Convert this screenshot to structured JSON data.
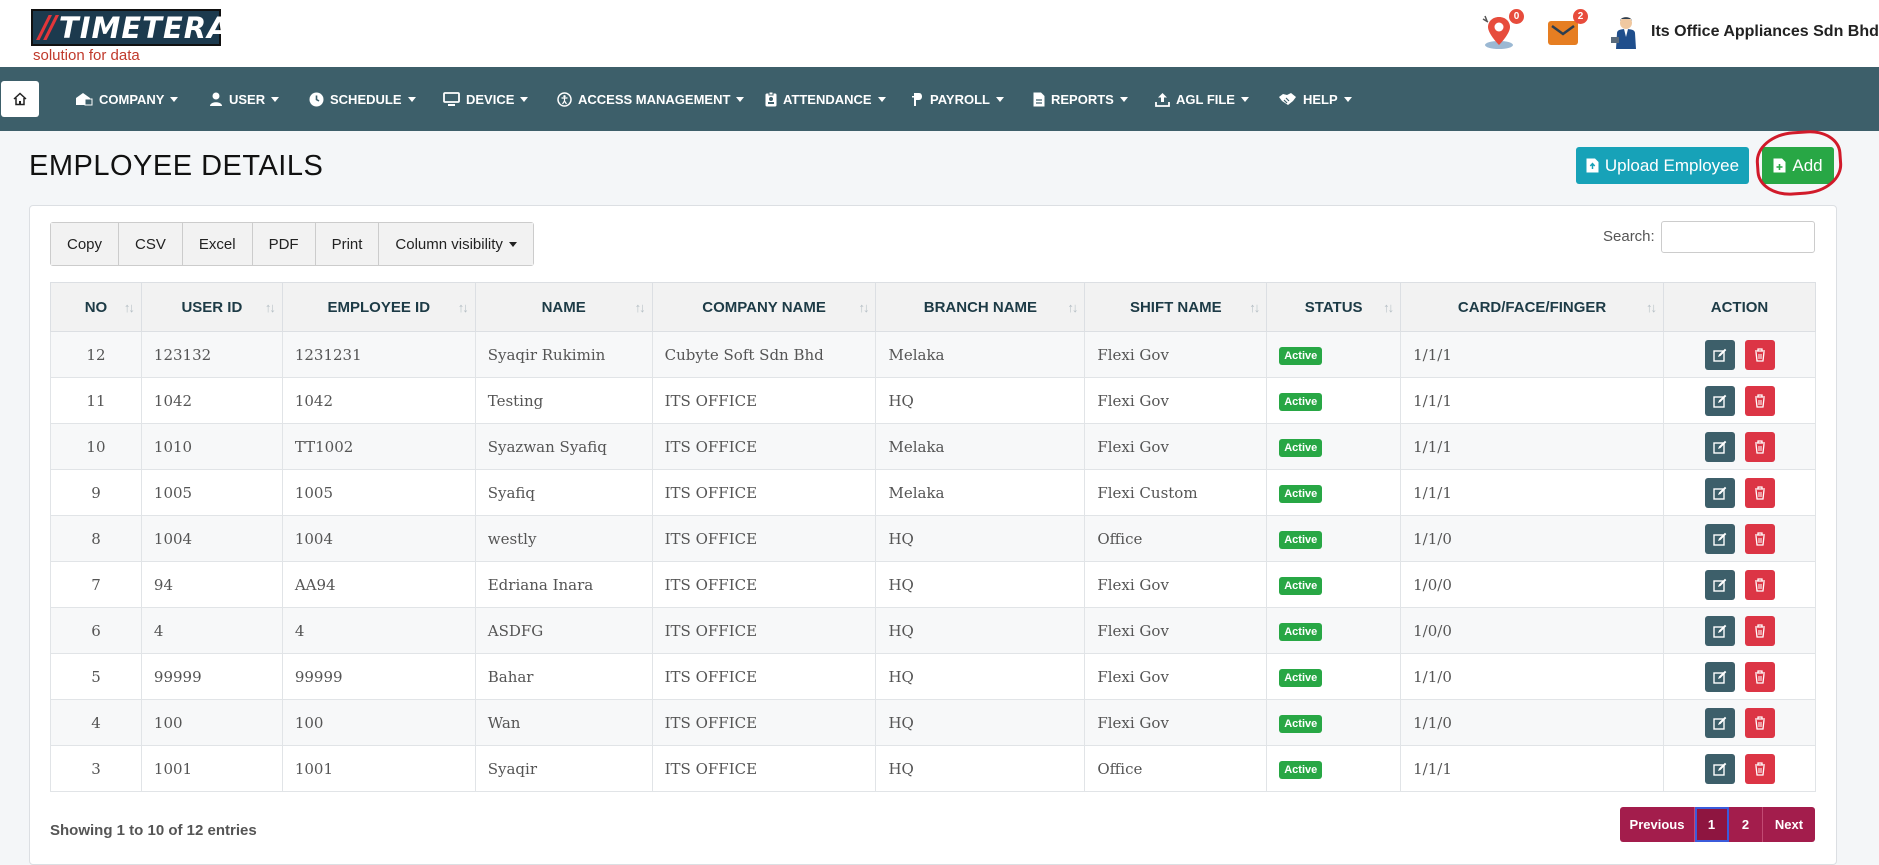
{
  "header": {
    "logo_text": "TIMETERA",
    "logo_slashes": "//",
    "logo_tagline": "solution for data",
    "location_badge": "0",
    "mail_badge": "2",
    "company": "Its Office Appliances Sdn Bhd"
  },
  "nav": {
    "items": [
      {
        "label": "COMPANY",
        "icon": "company-icon"
      },
      {
        "label": "USER",
        "icon": "user-icon"
      },
      {
        "label": "SCHEDULE",
        "icon": "clock-icon"
      },
      {
        "label": "DEVICE",
        "icon": "monitor-icon"
      },
      {
        "label": "ACCESS MANAGEMENT",
        "icon": "accessibility-icon"
      },
      {
        "label": "ATTENDANCE",
        "icon": "badge-icon"
      },
      {
        "label": "PAYROLL",
        "icon": "payroll-icon"
      },
      {
        "label": "REPORTS",
        "icon": "file-icon"
      },
      {
        "label": "AGL FILE",
        "icon": "upload-icon"
      },
      {
        "label": "HELP",
        "icon": "handshake-icon"
      }
    ]
  },
  "page": {
    "title": "EMPLOYEE DETAILS",
    "upload_label": "Upload Employee",
    "add_label": "Add"
  },
  "toolbar": {
    "buttons": [
      "Copy",
      "CSV",
      "Excel",
      "PDF",
      "Print",
      "Column visibility"
    ],
    "search_label": "Search:",
    "search_value": ""
  },
  "table": {
    "headers": [
      "NO",
      "USER ID",
      "EMPLOYEE ID",
      "NAME",
      "COMPANY NAME",
      "BRANCH NAME",
      "SHIFT NAME",
      "STATUS",
      "CARD/FACE/FINGER",
      "ACTION"
    ],
    "rows": [
      {
        "no": "12",
        "user_id": "123132",
        "employee_id": "1231231",
        "name": "Syaqir Rukimin",
        "company": "Cubyte Soft Sdn Bhd",
        "branch": "Melaka",
        "shift": "Flexi Gov",
        "status": "Active",
        "cff": "1/1/1"
      },
      {
        "no": "11",
        "user_id": "1042",
        "employee_id": "1042",
        "name": "Testing",
        "company": "ITS OFFICE",
        "branch": "HQ",
        "shift": "Flexi Gov",
        "status": "Active",
        "cff": "1/1/1"
      },
      {
        "no": "10",
        "user_id": "1010",
        "employee_id": "TT1002",
        "name": "Syazwan Syafiq",
        "company": "ITS OFFICE",
        "branch": "Melaka",
        "shift": "Flexi Gov",
        "status": "Active",
        "cff": "1/1/1"
      },
      {
        "no": "9",
        "user_id": "1005",
        "employee_id": "1005",
        "name": "Syafiq",
        "company": "ITS OFFICE",
        "branch": "Melaka",
        "shift": "Flexi Custom",
        "status": "Active",
        "cff": "1/1/1"
      },
      {
        "no": "8",
        "user_id": "1004",
        "employee_id": "1004",
        "name": "westly",
        "company": "ITS OFFICE",
        "branch": "HQ",
        "shift": "Office",
        "status": "Active",
        "cff": "1/1/0"
      },
      {
        "no": "7",
        "user_id": "94",
        "employee_id": "AA94",
        "name": "Edriana Inara",
        "company": "ITS OFFICE",
        "branch": "HQ",
        "shift": "Flexi Gov",
        "status": "Active",
        "cff": "1/0/0"
      },
      {
        "no": "6",
        "user_id": "4",
        "employee_id": "4",
        "name": "ASDFG",
        "company": "ITS OFFICE",
        "branch": "HQ",
        "shift": "Flexi Gov",
        "status": "Active",
        "cff": "1/0/0"
      },
      {
        "no": "5",
        "user_id": "99999",
        "employee_id": "99999",
        "name": "Bahar",
        "company": "ITS OFFICE",
        "branch": "HQ",
        "shift": "Flexi Gov",
        "status": "Active",
        "cff": "1/1/0"
      },
      {
        "no": "4",
        "user_id": "100",
        "employee_id": "100",
        "name": "Wan",
        "company": "ITS OFFICE",
        "branch": "HQ",
        "shift": "Flexi Gov",
        "status": "Active",
        "cff": "1/1/0"
      },
      {
        "no": "3",
        "user_id": "1001",
        "employee_id": "1001",
        "name": "Syaqir",
        "company": "ITS OFFICE",
        "branch": "HQ",
        "shift": "Office",
        "status": "Active",
        "cff": "1/1/1"
      }
    ]
  },
  "footer": {
    "showing": "Showing 1 to 10 of 12 entries",
    "prev": "Previous",
    "pages": [
      "1",
      "2"
    ],
    "next": "Next"
  },
  "colors": {
    "nav_bg": "#3d5f6a",
    "accent_teal": "#17a2b8",
    "accent_green": "#28a745",
    "danger": "#dc3545",
    "pager": "#a31d4c"
  }
}
